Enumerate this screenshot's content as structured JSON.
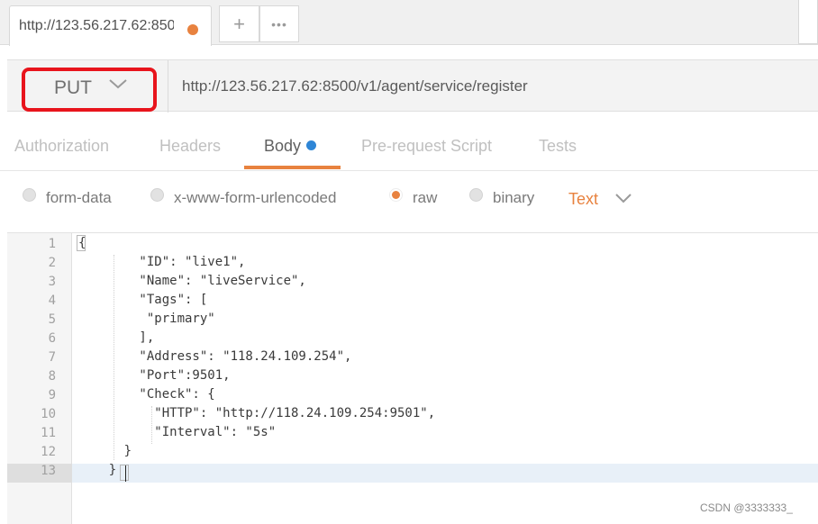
{
  "tab": {
    "title": "http://123.56.217.62:8500/v1/agent/service/register",
    "add_label": "+",
    "more_label": "•••",
    "modified_color": "#e8823f"
  },
  "request": {
    "method": "PUT",
    "url": "http://123.56.217.62:8500/v1/agent/service/register"
  },
  "subtabs": [
    "Authorization",
    "Headers",
    "Body",
    "Pre-request Script",
    "Tests"
  ],
  "active_subtab": "Body",
  "body_options": [
    "form-data",
    "x-www-form-urlencoded",
    "raw",
    "binary"
  ],
  "selected_option": "raw",
  "body_format": "Text",
  "code_lines": [
    "{",
    "        \"ID\": \"live1\",",
    "        \"Name\": \"liveService\",",
    "        \"Tags\": [",
    "         \"primary\"",
    "        ],",
    "        \"Address\": \"118.24.109.254\",",
    "        \"Port\":9501,",
    "        \"Check\": {",
    "          \"HTTP\": \"http://118.24.109.254:9501\",",
    "          \"Interval\": \"5s\"",
    "      }",
    "    }"
  ],
  "line_numbers": [
    "1",
    "2",
    "3",
    "4",
    "5",
    "6",
    "7",
    "8",
    "9",
    "10",
    "11",
    "12",
    "13"
  ],
  "watermark": "CSDN @3333333_",
  "colors": {
    "accent": "#e8823f",
    "highlight_outline": "#e8141c",
    "body_dot": "#2f86d6"
  }
}
